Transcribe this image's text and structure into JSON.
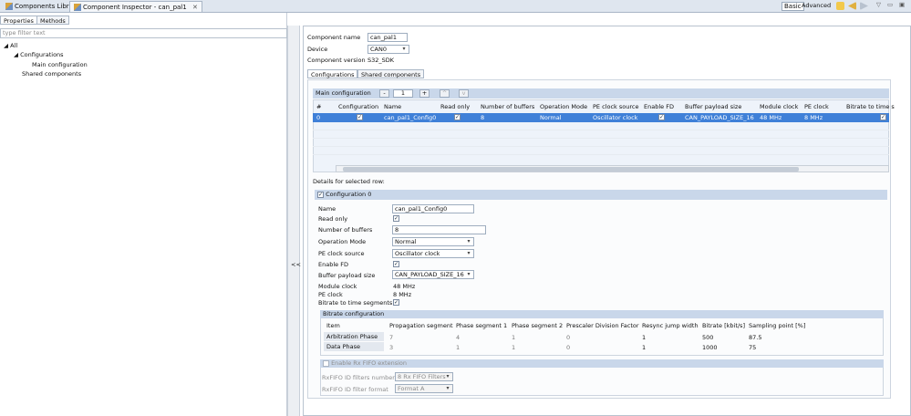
{
  "top_tabs": [
    {
      "label": "Components Library"
    },
    {
      "label": "Component Inspector - can_pal1"
    }
  ],
  "top_right": {
    "basic_label": "Basic",
    "advanced_label": "Advanced"
  },
  "left": {
    "tabs": [
      "Properties",
      "Methods"
    ],
    "filter_placeholder": "type filter text",
    "tree": [
      "All",
      "Configurations",
      "Main configuration",
      "Shared components"
    ]
  },
  "splitter_label": "<<",
  "component": {
    "name_label": "Component name",
    "name_value": "can_pal1",
    "device_label": "Device",
    "device_value": "CAN0",
    "version_label": "Component version",
    "version_value": "S32_SDK"
  },
  "inner_tabs": [
    "Configurations",
    "Shared components"
  ],
  "main_config": {
    "label": "Main configuration",
    "count": "1",
    "columns": [
      "#",
      "Configuration",
      "Name",
      "Read only",
      "Number of buffers",
      "Operation Mode",
      "PE clock source",
      "Enable FD",
      "Buffer payload size",
      "Module clock",
      "PE clock",
      "Bitrate to time s"
    ],
    "row": {
      "index": "0",
      "name": "can_pal1_Config0",
      "buffers": "8",
      "mode": "Normal",
      "clock_source": "Oscillator clock",
      "payload": "CAN_PAYLOAD_SIZE_16",
      "module_clock": "48 MHz",
      "pe_clock": "8 MHz"
    }
  },
  "details": {
    "heading": "Details for selected row:",
    "config_title": "Configuration 0",
    "fields": {
      "name_label": "Name",
      "name_value": "can_pal1_Config0",
      "readonly_label": "Read only",
      "buffers_label": "Number of buffers",
      "buffers_value": "8",
      "mode_label": "Operation Mode",
      "mode_value": "Normal",
      "clock_src_label": "PE clock source",
      "clock_src_value": "Oscillator clock",
      "fd_label": "Enable FD",
      "payload_label": "Buffer payload size",
      "payload_value": "CAN_PAYLOAD_SIZE_16",
      "module_clock_label": "Module clock",
      "module_clock_value": "48 MHz",
      "pe_clock_label": "PE clock",
      "pe_clock_value": "8 MHz",
      "bitrate_ts_label": "Bitrate to time segments"
    },
    "bitrate": {
      "title": "Bitrate configuration",
      "columns": [
        "Item",
        "Propagation segment",
        "Phase segment 1",
        "Phase segment 2",
        "Prescaler Division Factor",
        "Resync jump width",
        "Bitrate [kbit/s]",
        "Sampling point [%]"
      ],
      "rows": [
        [
          "Arbitration Phase",
          "7",
          "4",
          "1",
          "0",
          "1",
          "500",
          "87.5"
        ],
        [
          "Data Phase",
          "3",
          "1",
          "1",
          "0",
          "1",
          "1000",
          "75"
        ]
      ]
    },
    "rxfifo": {
      "title": "Enable Rx FIFO extension",
      "filters_label": "RxFIFO ID filters number",
      "filters_value": "8 Rx FIFO Filters",
      "format_label": "RxFIFO ID filter format",
      "format_value": "Format A"
    }
  }
}
